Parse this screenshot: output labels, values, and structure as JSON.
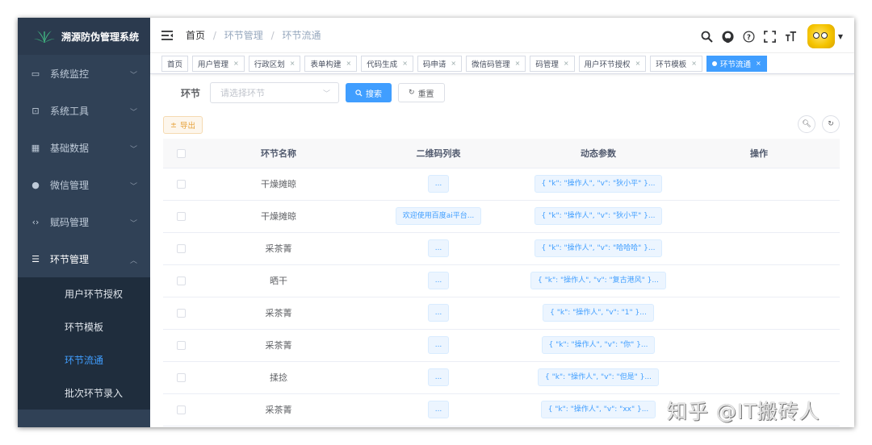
{
  "app": {
    "title": "溯源防伪管理系统"
  },
  "sidebar": {
    "items": [
      {
        "label": "系统监控",
        "icon": "monitor-icon"
      },
      {
        "label": "系统工具",
        "icon": "toolbox-icon"
      },
      {
        "label": "基础数据",
        "icon": "grid-icon"
      },
      {
        "label": "微信管理",
        "icon": "wechat-icon"
      },
      {
        "label": "赋码管理",
        "icon": "code-icon"
      },
      {
        "label": "环节管理",
        "icon": "list-icon"
      }
    ],
    "subitems": [
      {
        "label": "用户环节授权"
      },
      {
        "label": "环节模板"
      },
      {
        "label": "环节流通"
      },
      {
        "label": "批次环节录入"
      }
    ]
  },
  "breadcrumb": {
    "home": "首页",
    "sep": "/",
    "level1": "环节管理",
    "level2": "环节流通"
  },
  "tags": [
    {
      "label": "首页"
    },
    {
      "label": "用户管理"
    },
    {
      "label": "行政区划"
    },
    {
      "label": "表单构建"
    },
    {
      "label": "代码生成"
    },
    {
      "label": "码申请"
    },
    {
      "label": "微信码管理"
    },
    {
      "label": "码管理"
    },
    {
      "label": "用户环节授权"
    },
    {
      "label": "环节模板"
    },
    {
      "label": "环节流通"
    }
  ],
  "tag_close": "×",
  "search": {
    "label": "环节",
    "placeholder": "请选择环节",
    "search_button": "搜索",
    "reset_button": "重置"
  },
  "toolbar": {
    "export_label": "导出"
  },
  "table": {
    "headers": [
      "环节名称",
      "二维码列表",
      "动态参数",
      "操作"
    ],
    "rows": [
      {
        "name": "干燥摊晾",
        "qr": "...",
        "params": "{ \"k\": \"操作人\", \"v\": \"狄小平\" }..."
      },
      {
        "name": "干燥摊晾",
        "qr": "欢迎使用百度ai平台...",
        "params": "{ \"k\": \"操作人\", \"v\": \"狄小平\" }..."
      },
      {
        "name": "采茶菁",
        "qr": "...",
        "params": "{ \"k\": \"操作人\", \"v\": \"哈哈哈\" }..."
      },
      {
        "name": "晒干",
        "qr": "...",
        "params": "{ \"k\": \"操作人\", \"v\": \"复古港风\" }..."
      },
      {
        "name": "采茶菁",
        "qr": "...",
        "params": "{ \"k\": \"操作人\", \"v\": \"1\" }..."
      },
      {
        "name": "采茶菁",
        "qr": "...",
        "params": "{ \"k\": \"操作人\", \"v\": \"你\" }..."
      },
      {
        "name": "揉捻",
        "qr": "...",
        "params": "{ \"k\": \"操作人\", \"v\": \"但是\" }..."
      },
      {
        "name": "采茶菁",
        "qr": "...",
        "params": "{ \"k\": \"操作人\", \"v\": \"xx\" }..."
      }
    ]
  },
  "watermark": "知乎 @IT搬砖人",
  "colors": {
    "primary": "#409eff",
    "sidebar": "#304156",
    "warning": "#e6a23c"
  }
}
